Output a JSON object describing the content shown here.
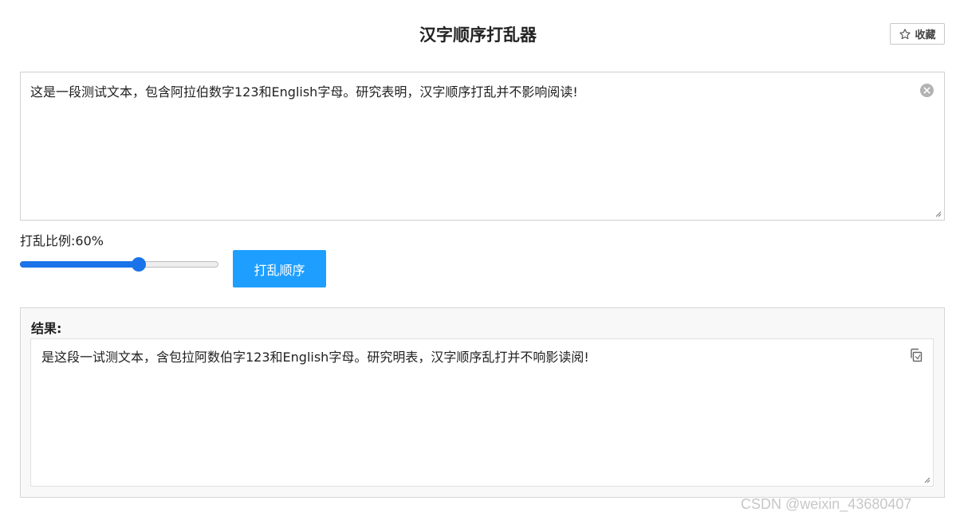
{
  "header": {
    "title": "汉字顺序打乱器",
    "favorite_label": "收藏",
    "favorite_icon": "star-outline-icon"
  },
  "input": {
    "value": "这是一段测试文本，包含阿拉伯数字123和English字母。研究表明，汉字顺序打乱并不影响阅读!",
    "clear_icon": "clear-circle-icon"
  },
  "controls": {
    "ratio_label": "打乱比例:",
    "ratio_value": "60%",
    "ratio": 0.6,
    "shuffle_button_label": "打乱顺序"
  },
  "result": {
    "label": "结果:",
    "value": "是这段一试测文本，含包拉阿数伯字123和English字母。研究明表，汉字顺序乱打并不响影读阅!",
    "copy_icon": "copy-icon"
  },
  "watermark": "CSDN @weixin_43680407",
  "colors": {
    "accent": "#1e9fff",
    "slider": "#1a73e8",
    "panel_bg": "#f8f8f8"
  }
}
